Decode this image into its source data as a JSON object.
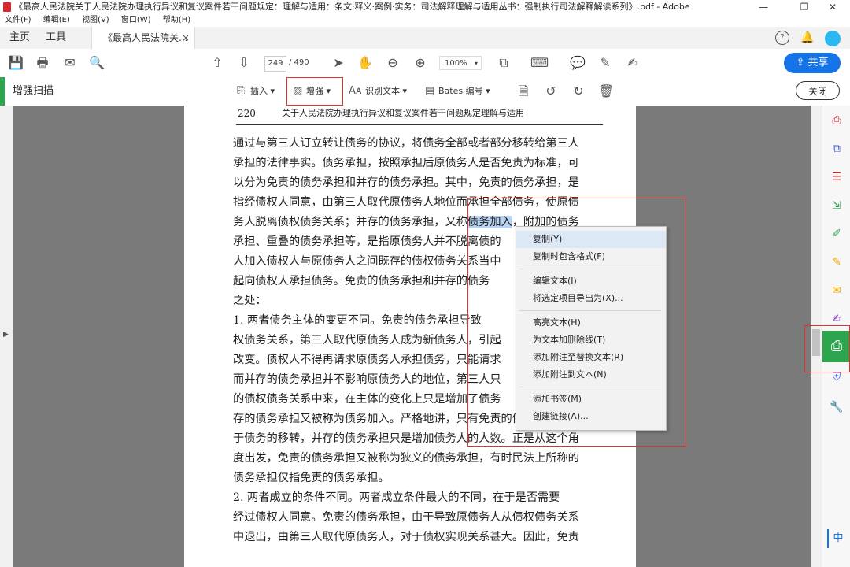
{
  "window": {
    "title": "《最高人民法院关于人民法院办理执行异议和复议案件若干问题规定：理解与适用：条文·释义·案例·实务：司法解释理解与适用丛书：强制执行司法解释解读系列》.pdf - Adobe Acrobat Pro DC",
    "controls": [
      "—",
      "❐",
      "✕"
    ]
  },
  "menu": [
    "文件(F)",
    "编辑(E)",
    "视图(V)",
    "窗口(W)",
    "帮助(H)"
  ],
  "tabs": {
    "home": "主页",
    "tools": "工具",
    "document": "《最高人民法院关...",
    "close": "×"
  },
  "toolbar": {
    "current_page": "249",
    "page_total": "/ 490",
    "zoom": "100%",
    "share_label": "共享"
  },
  "tools_bar": {
    "tool_name": "增强扫描",
    "insert": "插入",
    "enhance": "增强",
    "recognize_text": "识别文本",
    "bates": "Bates 编号",
    "close": "关闭"
  },
  "page": {
    "page_number": "220",
    "running_header": "关于人民法院办理执行异议和复议案件若干问题规定理解与适用",
    "lines": [
      "通过与第三人订立转让债务的协议，将债务全部或者部分移转给第三人",
      "承担的法律事实。债务承担，按照承担后原债务人是否免责为标准，可",
      "以分为免责的债务承担和并存的债务承担。其中，免责的债务承担，是",
      "指经债权人同意，由第三人取代原债务人地位而承担全部债务，使原债",
      "务人脱离债权债务关系；并存的债务承担，又称",
      "承担、重叠的债务承担等，是指原债务人并不脱离债的",
      "人加入债权人与原债务人之间既存的债权债务关系当中",
      "起向债权人承担债务。免责的债务承担和并存的债务",
      "之处：",
      "    1. 两者债务主体的变更不同。免责的债务承担导致",
      "权债务关系，第三人取代原债务人成为新债务人，引起",
      "改变。债权人不得再请求原债务人承担债务，只能请求",
      "而并存的债务承担并不影响原债务人的地位，第三人只",
      "的债权债务关系中来，在主体的变化上只是增加了债务",
      "存的债务承担又被称为债务加入。严格地讲，只有免责的债务承担才属",
      "于债务的移转，并存的债务承担只是增加债务人的人数。正是从这个角",
      "度出发，免责的债务承担又被称为狭义的债务承担，有时民法上所称的",
      "债务承担仅指免责的债务承担。",
      "    2. 两者成立的条件不同。两者成立条件最大的不同，在于是否需要",
      "经过债权人同意。免责的债务承担，由于导致原债务人从债权债务关系",
      "中退出，由第三人取代原债务人，对于债权实现关系甚大。因此，免责"
    ],
    "highlight": "债务加入",
    "after_highlight": "，附加的债务"
  },
  "context_menu": {
    "items": [
      "复制(Y)",
      "复制时包含格式(F)",
      "编辑文本(I)",
      "将选定项目导出为(X)...",
      "高亮文本(H)",
      "为文本加删除线(T)",
      "添加附注至替换文本(R)",
      "添加附注到文本(N)",
      "添加书签(M)",
      "创建链接(A)..."
    ]
  },
  "right_pane": {
    "language": "中"
  },
  "colors": {
    "accent_blue": "#1473e6",
    "tool_green": "#2da44e",
    "annotation_red": "#e03131",
    "selection": "#b7d3ef"
  }
}
